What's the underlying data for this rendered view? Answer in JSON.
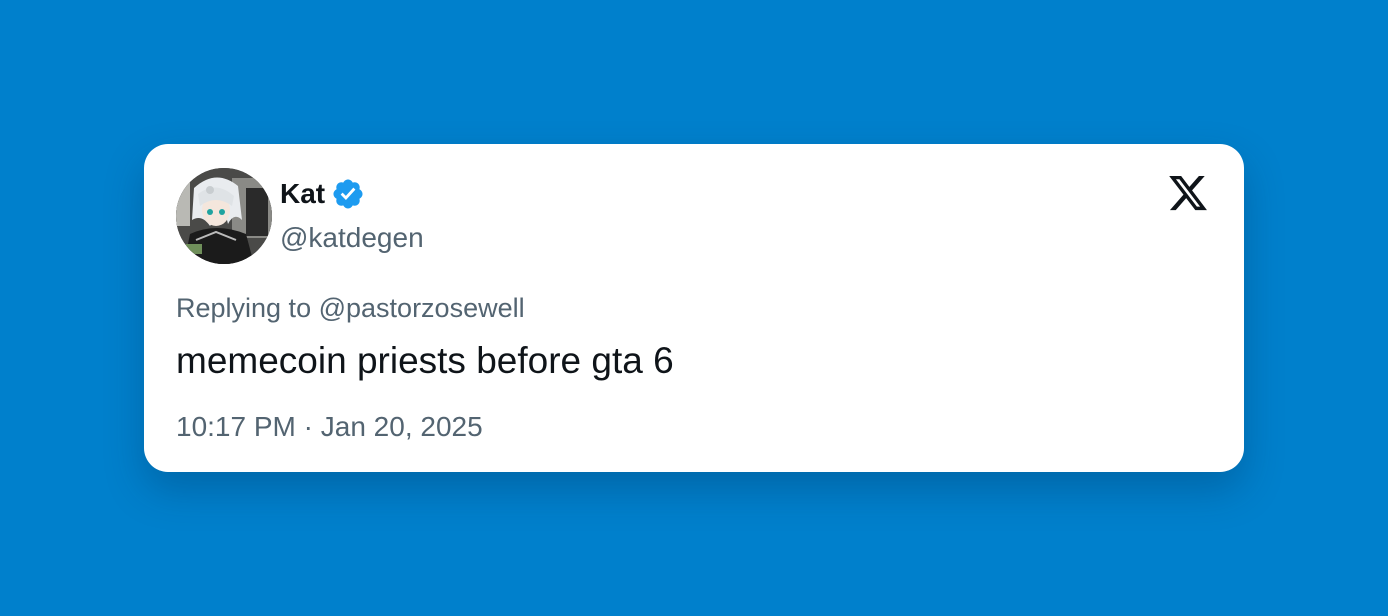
{
  "colors": {
    "background": "#0080cc",
    "card": "#ffffff",
    "text_primary": "#0f1419",
    "text_secondary": "#536471",
    "verified_badge": "#1d9bf0"
  },
  "tweet": {
    "author": {
      "name": "Kat",
      "handle": "@katdegen",
      "verified": true,
      "avatar_icon": "anime-character-avatar"
    },
    "replying_to_prefix": "Replying to",
    "replying_to_handle": "@pastorzosewell",
    "text": "memecoin priests before gta 6",
    "time": "10:17 PM",
    "separator": "·",
    "date": "Jan 20, 2025",
    "platform_icon": "x-logo-icon"
  }
}
